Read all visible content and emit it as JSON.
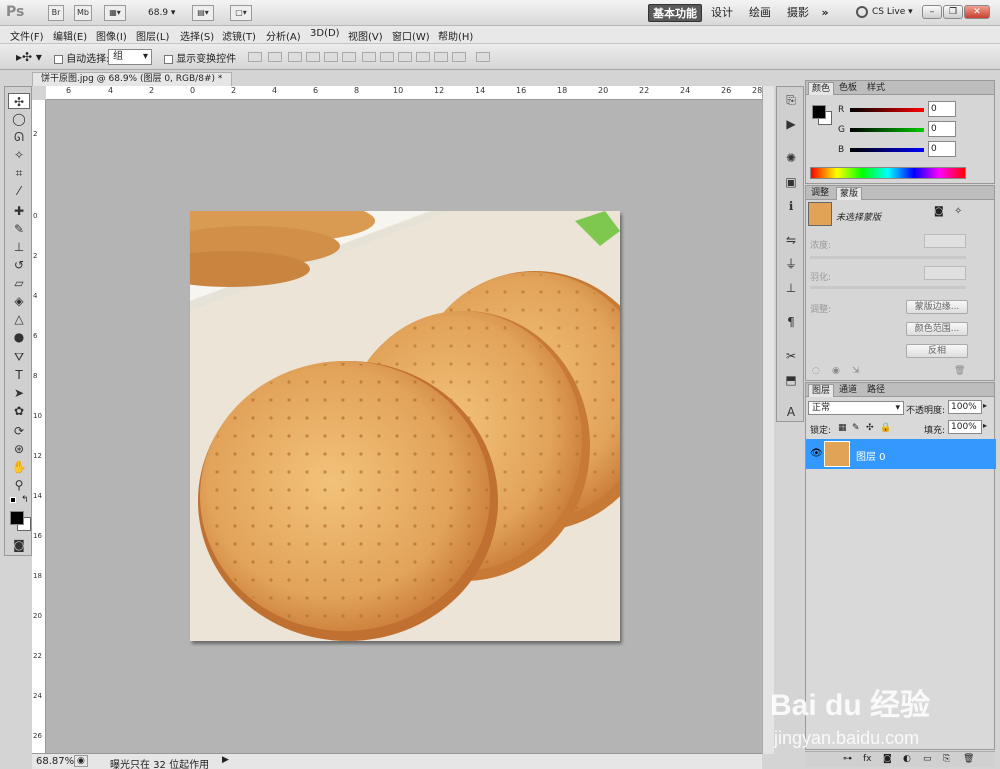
{
  "titlebar": {
    "app_logo": "Ps",
    "br_label": "Br",
    "mb_label": "Mb",
    "zoom_value": "68.9",
    "workspaces": {
      "basic": "基本功能",
      "design": "设计",
      "painting": "绘画",
      "photography": "摄影",
      "more": "»"
    },
    "cs_live": "CS Live"
  },
  "menu": {
    "items": [
      "文件(F)",
      "编辑(E)",
      "图像(I)",
      "图层(L)",
      "选择(S)",
      "滤镜(T)",
      "分析(A)",
      "3D(D)",
      "视图(V)",
      "窗口(W)",
      "帮助(H)"
    ]
  },
  "options": {
    "auto_select_label": "自动选择:",
    "auto_select_value": "组",
    "show_transform_label": "显示变换控件"
  },
  "document": {
    "tab_title": "饼干原图.jpg @ 68.9% (图层 0, RGB/8#) *",
    "close": "×"
  },
  "ruler": {
    "top_ticks": [
      "6",
      "4",
      "2",
      "0",
      "2",
      "4",
      "6",
      "8",
      "10",
      "12",
      "14",
      "16",
      "18",
      "20",
      "22",
      "24",
      "26",
      "28"
    ],
    "left_ticks": [
      "2",
      "0",
      "2",
      "4",
      "6",
      "8",
      "10",
      "12",
      "14",
      "16",
      "18",
      "20",
      "22",
      "24",
      "26"
    ]
  },
  "status": {
    "zoom": "68.87%",
    "message": "曝光只在 32 位起作用"
  },
  "color_panel": {
    "tabs": [
      "颜色",
      "色板",
      "样式"
    ],
    "r_label": "R",
    "g_label": "G",
    "b_label": "B",
    "r_value": "0",
    "g_value": "0",
    "b_value": "0"
  },
  "masks_panel": {
    "tabs": [
      "调整",
      "蒙版"
    ],
    "no_mask": "未选择蒙版",
    "density": "浓度:",
    "feather": "羽化:",
    "refine": "调整:",
    "mask_edge_btn": "蒙版边缘...",
    "color_range_btn": "颜色范围...",
    "invert_btn": "反相"
  },
  "layers_panel": {
    "tabs": [
      "图层",
      "通道",
      "路径"
    ],
    "blend_mode": "正常",
    "opacity_label": "不透明度:",
    "opacity_value": "100%",
    "lock_label": "锁定:",
    "fill_label": "填充:",
    "fill_value": "100%",
    "layer_name": "图层 0"
  },
  "watermark": {
    "brand": "Bai du 经验",
    "url": "jingyan.baidu.com"
  },
  "colors": {
    "selection_blue": "#3399ff",
    "canvas_gray": "#b4b4b4",
    "cookie": "#e1a457"
  }
}
